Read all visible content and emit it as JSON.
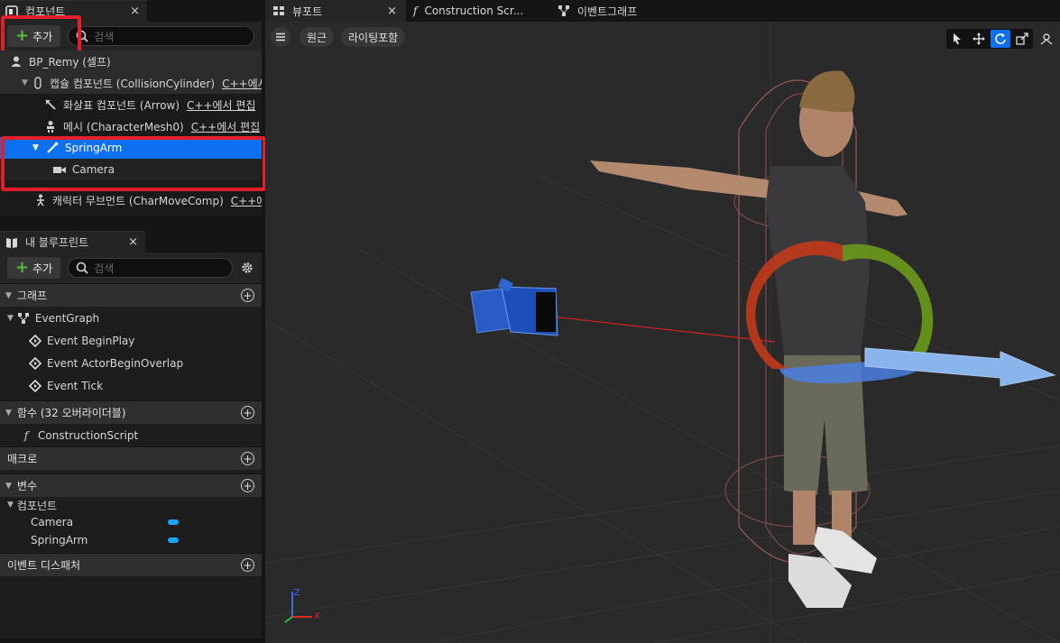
{
  "components_panel": {
    "tab_title": "컴포넌트",
    "close": "×",
    "add_label": "추가",
    "search_placeholder": "검색",
    "items": [
      {
        "label": "BP_Remy (셀프)",
        "tag": ""
      },
      {
        "label": "캡슐 컴포넌트 (CollisionCylinder)",
        "tag": "C++에서 편집"
      },
      {
        "label": "화살표 컴포넌트 (Arrow)",
        "tag": "C++에서 편집"
      },
      {
        "label": "메시 (CharacterMesh0)",
        "tag": "C++에서 편집"
      },
      {
        "label": "SpringArm",
        "tag": ""
      },
      {
        "label": "Camera",
        "tag": ""
      },
      {
        "label": "캐릭터 무브먼트 (CharMoveComp)",
        "tag": "C++에서 편집"
      }
    ]
  },
  "blueprint_panel": {
    "tab_title": "내 블루프린트",
    "close": "×",
    "add_label": "추가",
    "search_placeholder": "검색",
    "graph_section": "그래프",
    "event_graph": "EventGraph",
    "events": [
      "Event BeginPlay",
      "Event ActorBeginOverlap",
      "Event Tick"
    ],
    "functions_section": "함수 (32 오버라이더블)",
    "construction_script": "ConstructionScript",
    "macros_section": "매크로",
    "variables_section": "변수",
    "components_group": "컴포넌트",
    "variables": [
      "Camera",
      "SpringArm"
    ],
    "dispatchers_section": "이벤트 디스패처"
  },
  "viewport": {
    "tabs": [
      {
        "label": "뷰포트",
        "close": "×"
      },
      {
        "label": "Construction Scr...",
        "close": ""
      },
      {
        "label": "이벤트그래프",
        "close": ""
      }
    ],
    "perspective_label": "원근",
    "lighting_label": "라이팅포함",
    "axis_x": "X",
    "axis_z": "Z",
    "colors": {
      "selection": "#0d70f0",
      "highlight": "#e3202a",
      "accent_green": "#4fbf3a"
    }
  }
}
